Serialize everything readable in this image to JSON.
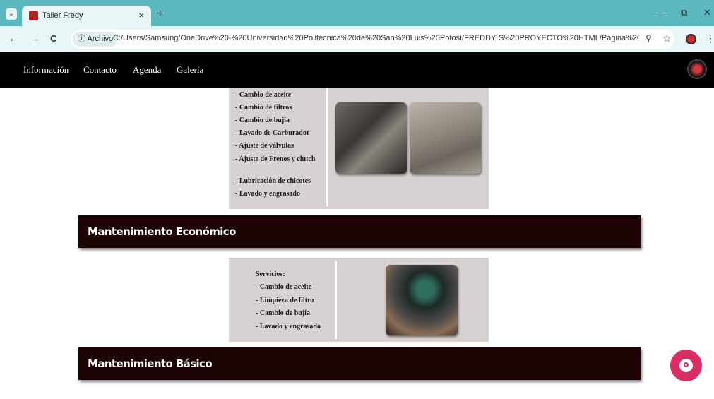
{
  "browser": {
    "tab_title": "Taller Fredy",
    "tab_close": "×",
    "new_tab": "+",
    "tab_menu": "⌄",
    "site_chip": "ⓘ Archivo",
    "url": "C:/Users/Samsung/OneDrive%20-%20Universidad%20Politécnica%20de%20San%20Luis%20Potosí/FREDDY´S%20PROYECTO%20HTML/Página%20web/Proyect...",
    "back": "←",
    "forward": "→",
    "reload": "C",
    "zoom": "⚲",
    "bookmark": "☆",
    "kebab": "⋮",
    "minimize": "–",
    "restore": "⧉",
    "close": "✕"
  },
  "nav": {
    "items": [
      "Información",
      "Contacto",
      "Agenda",
      "Galería"
    ]
  },
  "section_top": {
    "services": [
      "- Cambio de aceite",
      "- Cambio de filtros",
      "- Cambio de bujía",
      "- Lavado de Carburador",
      "- Ajuste de válvulas",
      "- Ajuste de Frenos y clutch",
      "- Lubricación de chicotes",
      "- Lavado y engrasado"
    ]
  },
  "banner_economico": {
    "title": "Mantenimiento Económico"
  },
  "section_economico": {
    "heading": "Servicios:",
    "services": [
      "- Cambio de aceite",
      "- Limpieza de filtro",
      "- Cambio de bujía",
      "- Lavado y engrasado"
    ]
  },
  "banner_basico": {
    "title": "Mantenimiento Básico"
  },
  "colors": {
    "tabbar": "#5bb8bf",
    "nav_bg": "#000000",
    "panel_bg": "#d8d1d2",
    "banner_bg": "#1e0304",
    "chat_fab": "#d92d64"
  }
}
